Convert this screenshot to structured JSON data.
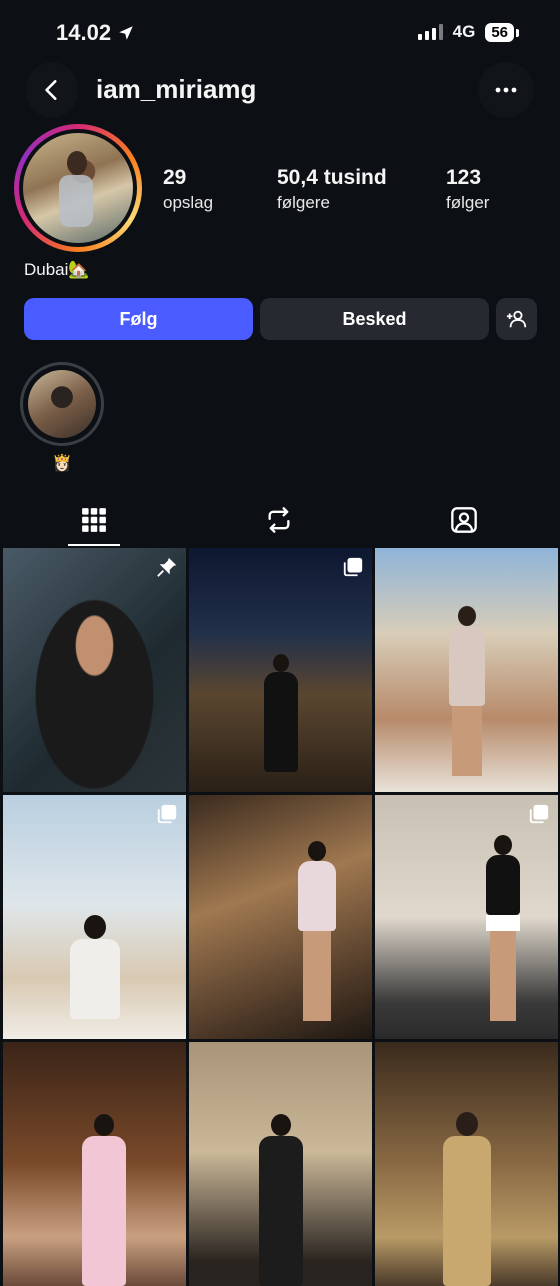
{
  "status_bar": {
    "time": "14.02",
    "network": "4G",
    "battery": "56"
  },
  "header": {
    "username": "iam_miriamg"
  },
  "stats": [
    {
      "value": "29",
      "label": "opslag"
    },
    {
      "value": "50,4 tusind",
      "label": "følgere"
    },
    {
      "value": "123",
      "label": "følger"
    }
  ],
  "bio": {
    "text": "Dubai",
    "emoji": "🏡"
  },
  "actions": {
    "follow_label": "Følg",
    "message_label": "Besked"
  },
  "highlights": [
    {
      "label": "👸🏻"
    }
  ],
  "tabs": [
    {
      "name": "posts-grid"
    },
    {
      "name": "reels"
    },
    {
      "name": "tagged"
    }
  ],
  "grid": [
    {
      "badge": "pin-icon"
    },
    {
      "badge": "carousel-icon"
    },
    {
      "badge": ""
    },
    {
      "badge": "carousel-icon"
    },
    {
      "badge": ""
    },
    {
      "badge": "carousel-icon"
    },
    {
      "badge": ""
    },
    {
      "badge": ""
    },
    {
      "badge": ""
    }
  ],
  "colors": {
    "accent": "#4a5cff",
    "background": "#0c1014",
    "secondary_button": "#262a30"
  }
}
